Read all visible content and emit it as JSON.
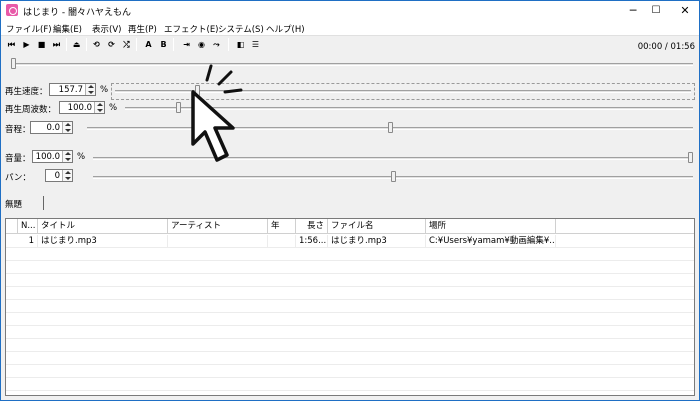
{
  "window": {
    "title": "はじまり - 闇々ハヤえもん"
  },
  "window_controls": {
    "minimize": "─",
    "maximize": "☐",
    "close": "✕"
  },
  "menu": [
    "ファイル(F)",
    "編集(E)",
    "表示(V)",
    "再生(P)",
    "エフェクト(E)",
    "システム(S)",
    "ヘルプ(H)"
  ],
  "toolbar": {
    "time": "00:00 / 01:56",
    "a_label": "A",
    "b_label": "B"
  },
  "params": {
    "speed": {
      "label": "再生速度：",
      "value": "157.7",
      "unit": "%",
      "level": 0.14
    },
    "frequency": {
      "label": "再生周波数：",
      "value": "100.0",
      "unit": "%",
      "level": 0.09
    },
    "pitch": {
      "label": "音程：",
      "value": "0.0",
      "level": 0.5
    },
    "volume": {
      "label": "音量：",
      "value": "100.0",
      "unit": "%",
      "level": 1.0
    },
    "pan": {
      "label": "パン：",
      "value": "0",
      "level": 0.5
    }
  },
  "position_level": 0.0,
  "tab": {
    "label": "無題"
  },
  "playlist": {
    "columns": [
      "N...",
      "タイトル",
      "アーティスト",
      "年",
      "長さ",
      "ファイル名",
      "場所"
    ],
    "rows": [
      {
        "no": "1",
        "title": "はじまり.mp3",
        "artist": "",
        "year": "",
        "length": "1:56...",
        "filename": "はじまり.mp3",
        "location": "C:¥Users¥yamam¥動画編集¥..."
      }
    ]
  }
}
